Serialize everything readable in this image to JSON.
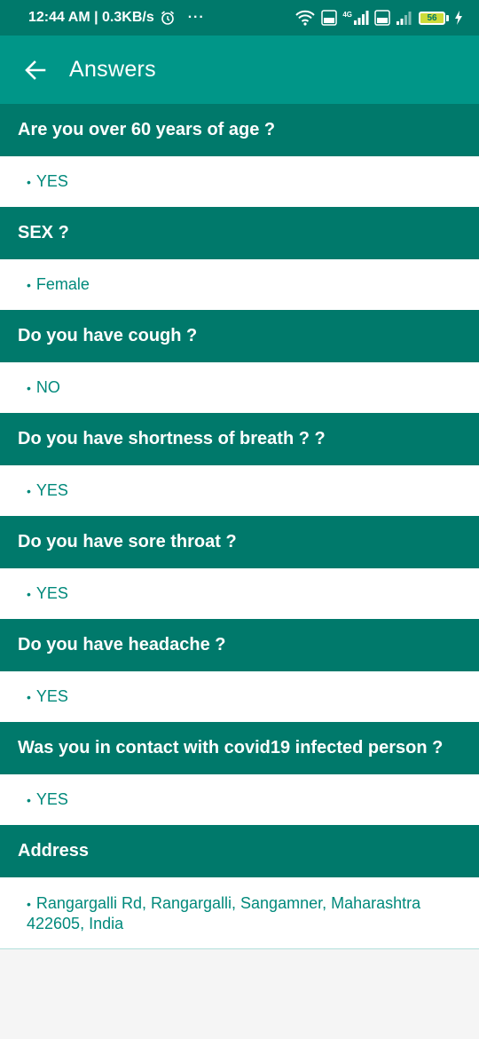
{
  "status_bar": {
    "time_speed": "12:44 AM | 0.3KB/s",
    "more": "···",
    "net_4g": "4G",
    "battery": "56"
  },
  "app_bar": {
    "title": "Answers"
  },
  "qa": [
    {
      "question": "Are you over 60 years of age ?",
      "answer": "YES"
    },
    {
      "question": "SEX ?",
      "answer": "Female"
    },
    {
      "question": "Do you have cough ?",
      "answer": "NO"
    },
    {
      "question": "Do you have shortness of breath ? ?",
      "answer": "YES"
    },
    {
      "question": "Do you have sore throat ?",
      "answer": "YES"
    },
    {
      "question": "Do you have headache ?",
      "answer": "YES"
    },
    {
      "question": "Was you in contact with covid19 infected person ?",
      "answer": "YES"
    },
    {
      "question": "Address",
      "answer": "Rangargalli Rd, Rangargalli, Sangamner, Maharashtra 422605, India"
    }
  ],
  "bullet": "•",
  "colors": {
    "status_bar": "#00796b",
    "app_bar": "#009688",
    "question_bg": "#00796b",
    "answer_text": "#00897b"
  }
}
